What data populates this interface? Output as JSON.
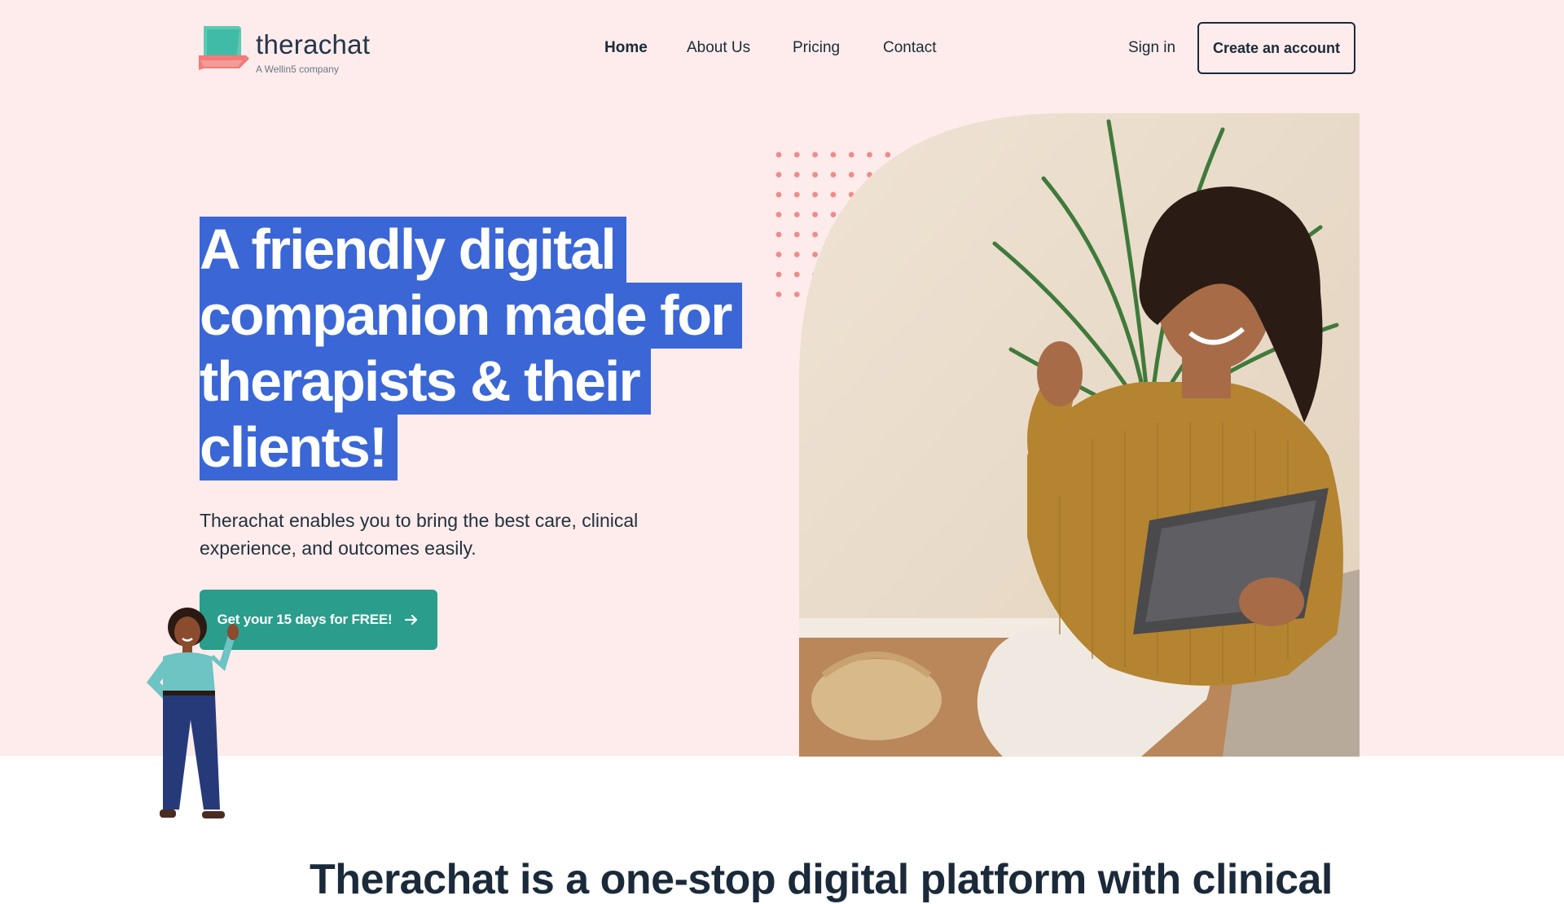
{
  "brand": {
    "name": "therachat",
    "tagline": "A Wellin5 company"
  },
  "nav": {
    "items": [
      {
        "label": "Home",
        "active": true
      },
      {
        "label": "About Us",
        "active": false
      },
      {
        "label": "Pricing",
        "active": false
      },
      {
        "label": "Contact",
        "active": false
      }
    ]
  },
  "auth": {
    "signin_label": "Sign in",
    "create_label": "Create an account"
  },
  "hero": {
    "headline_lines": [
      "A friendly digital",
      "companion made for",
      "therapists & their",
      "clients!"
    ],
    "subcopy": "Therachat enables you to bring the best care, clinical experience, and outcomes easily.",
    "cta_label": "Get your 15 days for FREE!",
    "cta_icon": "arrow-right-icon",
    "photo": "woman-with-tablet-photo",
    "illustration": "waving-woman-illustration"
  },
  "section": {
    "title": "Therachat is a one-stop digital platform with clinical"
  },
  "colors": {
    "hero_bg": "#fdeceb",
    "highlight": "#3a66d6",
    "cta": "#2a9d8c",
    "dots": "#f28a8a",
    "text": "#1b2a3a"
  }
}
